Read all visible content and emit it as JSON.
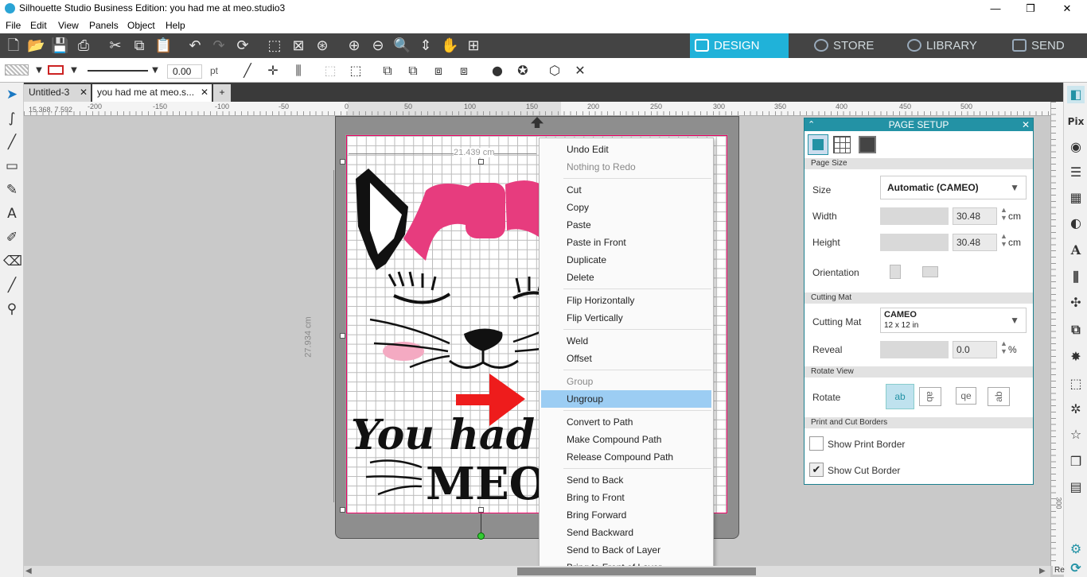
{
  "window": {
    "title": "Silhouette Studio Business Edition: you had me at meo.studio3",
    "minimize": "—",
    "restore": "❐",
    "close": "✕"
  },
  "menubar": [
    "File",
    "Edit",
    "View",
    "Panels",
    "Object",
    "Help"
  ],
  "toolbar": {
    "line_width_value": "0.00",
    "line_width_unit": "pt"
  },
  "nav_tabs": [
    "DESIGN",
    "STORE",
    "LIBRARY",
    "SEND"
  ],
  "doc_tabs": [
    {
      "label": "Untitled-3"
    },
    {
      "label": "you had me at meo.s..."
    }
  ],
  "add_tab": "+",
  "ruler": {
    "coords": "15.368, 7.592",
    "h_ticks": [
      "-250",
      "-200",
      "-150",
      "-100",
      "-50",
      "0",
      "50",
      "100",
      "150",
      "200",
      "250",
      "300",
      "350",
      "400",
      "450",
      "500"
    ],
    "v_ticks": [
      "300"
    ]
  },
  "artwork": {
    "width_dim": "21.439 cm",
    "height_dim": "27.934 cm",
    "line1": "You had m",
    "line2": "MEOW"
  },
  "context_menu": {
    "items": [
      {
        "label": "Undo Edit",
        "state": "enabled"
      },
      {
        "label": "Nothing to Redo",
        "state": "disabled"
      },
      {
        "label": "Cut",
        "state": "enabled"
      },
      {
        "label": "Copy",
        "state": "enabled"
      },
      {
        "label": "Paste",
        "state": "enabled"
      },
      {
        "label": "Paste in Front",
        "state": "enabled"
      },
      {
        "label": "Duplicate",
        "state": "enabled"
      },
      {
        "label": "Delete",
        "state": "enabled"
      },
      {
        "label": "Flip Horizontally",
        "state": "enabled"
      },
      {
        "label": "Flip Vertically",
        "state": "enabled"
      },
      {
        "label": "Weld",
        "state": "enabled"
      },
      {
        "label": "Offset",
        "state": "enabled"
      },
      {
        "label": "Group",
        "state": "disabled"
      },
      {
        "label": "Ungroup",
        "state": "highlighted"
      },
      {
        "label": "Convert to Path",
        "state": "enabled"
      },
      {
        "label": "Make Compound Path",
        "state": "enabled"
      },
      {
        "label": "Release Compound Path",
        "state": "enabled"
      },
      {
        "label": "Send to Back",
        "state": "enabled"
      },
      {
        "label": "Bring to Front",
        "state": "enabled"
      },
      {
        "label": "Bring Forward",
        "state": "enabled"
      },
      {
        "label": "Send Backward",
        "state": "enabled"
      },
      {
        "label": "Send to Back of Layer",
        "state": "enabled"
      },
      {
        "label": "Bring to Front of Layer",
        "state": "enabled"
      }
    ]
  },
  "page_setup": {
    "title": "PAGE SETUP",
    "close": "✕",
    "sections": {
      "page_size": "Page Size",
      "cutting_mat": "Cutting Mat",
      "rotate_view": "Rotate View",
      "borders": "Print and Cut Borders"
    },
    "size": {
      "label": "Size",
      "value": "Automatic (CAMEO)"
    },
    "width": {
      "label": "Width",
      "value": "30.48",
      "unit": "cm"
    },
    "height": {
      "label": "Height",
      "value": "30.48",
      "unit": "cm"
    },
    "orientation": {
      "label": "Orientation"
    },
    "cutting_mat": {
      "label": "Cutting Mat",
      "value": "CAMEO",
      "sub": "12 x 12 in"
    },
    "reveal": {
      "label": "Reveal",
      "value": "0.0",
      "unit": "%"
    },
    "rotate": {
      "label": "Rotate",
      "options": [
        "ab",
        "ab",
        "qe",
        "ab"
      ]
    },
    "show_print_border": {
      "label": "Show Print Border",
      "checked": false
    },
    "show_cut_border": {
      "label": "Show Cut Border",
      "checked": true
    }
  },
  "right_panel": {
    "pix_label": "Pix",
    "bottom_text": "Re"
  },
  "colors": {
    "accent": "#2392a5",
    "design_tab": "#20b2d9",
    "highlight": "#9ccdf3",
    "pink": "#e73c7e",
    "arrow": "#ee1c1c"
  }
}
